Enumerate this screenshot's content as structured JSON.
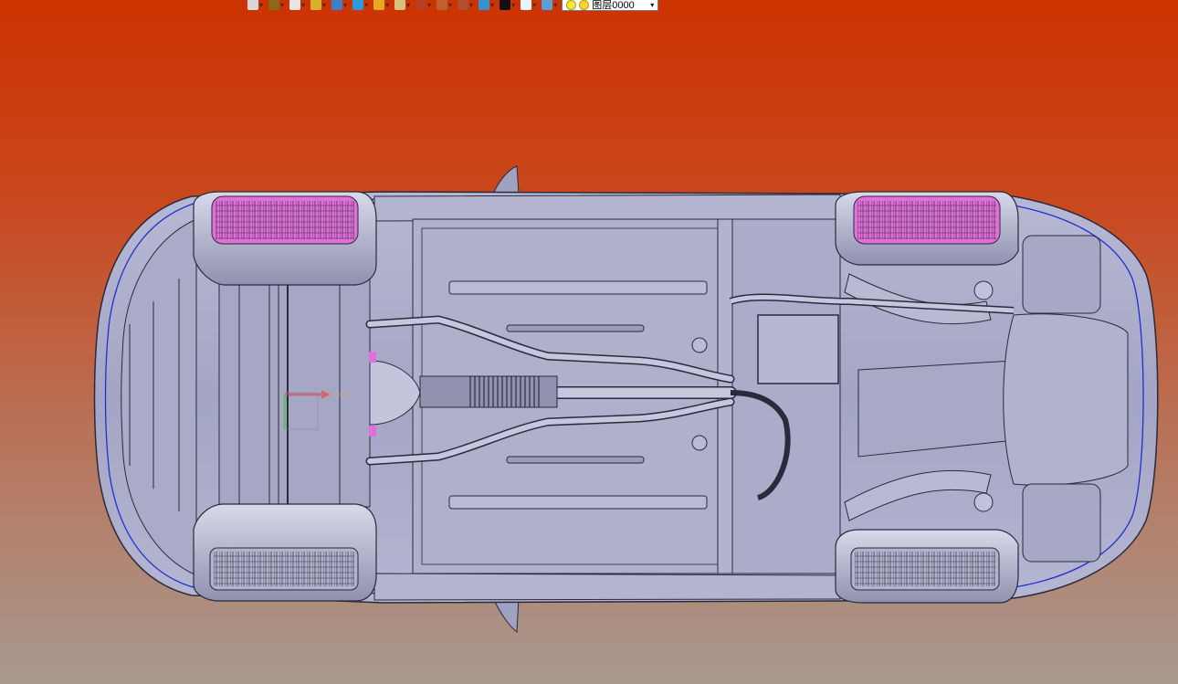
{
  "toolbar": {
    "buttons": [
      {
        "name": "new-document-icon",
        "color": "#d8d8d8"
      },
      {
        "name": "paint-bucket-icon",
        "color": "#8a6a1a"
      },
      {
        "name": "pointer-arrow-icon",
        "color": "#e6e6e6"
      },
      {
        "name": "box-yellow-icon",
        "color": "#d8b030"
      },
      {
        "name": "cube-blue-icon",
        "color": "#3a7fd0"
      },
      {
        "name": "cube-cyan-icon",
        "color": "#2f9ad8"
      },
      {
        "name": "render-sphere-icon",
        "color": "#e8a820"
      },
      {
        "name": "clipboard-icon",
        "color": "#d8c080"
      },
      {
        "name": "crosshair-icon",
        "color": "#b84020"
      },
      {
        "name": "copy-icon",
        "color": "#c06030"
      },
      {
        "name": "paste-icon",
        "color": "#b05030"
      },
      {
        "name": "monitor-icon",
        "color": "#3a8fd0"
      },
      {
        "name": "color-black-swatch-icon",
        "color": "#111111"
      },
      {
        "name": "color-white-swatch-icon",
        "color": "#e8f4ff"
      },
      {
        "name": "layer-stack-icon",
        "color": "#5aa0d8"
      }
    ],
    "layer_selector": {
      "value": "图层0000"
    }
  },
  "viewport": {
    "background_top": "#cc3300",
    "background_bottom": "#a8998f"
  },
  "colors": {
    "body": "#a9abc8",
    "body_dark": "#8e90b0",
    "line": "#2a2a3a",
    "wheel_highlight": "#e070d8",
    "outline_blue": "#2030d0"
  }
}
